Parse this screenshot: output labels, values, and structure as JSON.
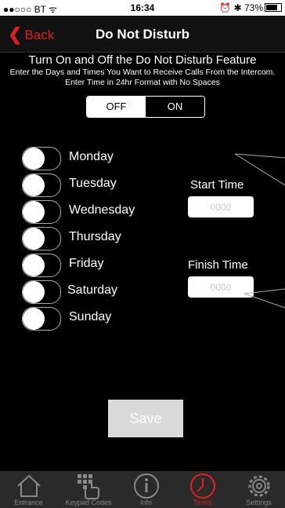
{
  "status": {
    "carrier": "●●○○○ BT ᯤ",
    "time": "16:34",
    "right": "⏰ ✱ 73%"
  },
  "nav": {
    "back_label": "Back",
    "title": "Do Not Disturb"
  },
  "heading": "Turn On and Off the Do Not Disturb Feature",
  "subtext": "Enter the Days and Times You Want to Receive Calls From the Intercom.    Enter Time in 24hr Format with No Spaces",
  "toggle": {
    "off_label": "OFF",
    "on_label": "ON",
    "selected": "OFF"
  },
  "days": [
    "Monday",
    "Tuesday",
    "Wednesday",
    "Thursday",
    "Friday",
    "Saturday",
    "Sunday"
  ],
  "start": {
    "label": "Start Time",
    "placeholder": "0000"
  },
  "finish": {
    "label": "Finish Time",
    "placeholder": "0000"
  },
  "save_label": "Save",
  "tabs": [
    {
      "label": "Entrance",
      "icon": "home-icon"
    },
    {
      "label": "Keypad Codes",
      "icon": "keypad-icon"
    },
    {
      "label": "Info",
      "icon": "info-icon"
    },
    {
      "label": "Times",
      "icon": "clock-icon"
    },
    {
      "label": "Settings",
      "icon": "gear-icon"
    }
  ],
  "colors": {
    "accent": "#e02020",
    "background": "#000000",
    "tabbar": "#2a2a2a"
  }
}
